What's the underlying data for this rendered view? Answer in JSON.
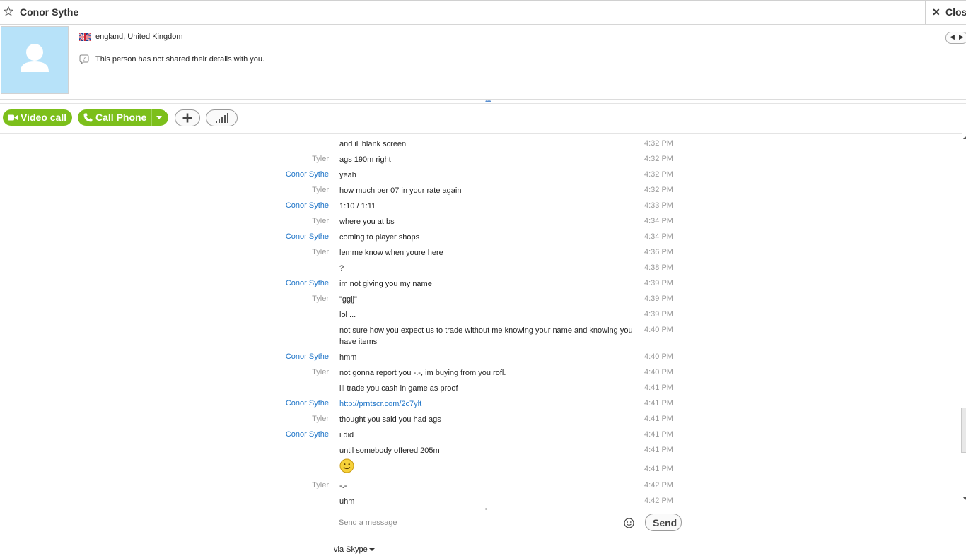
{
  "window": {
    "contact_name": "Conor Sythe",
    "close_label": "Close"
  },
  "profile": {
    "location": "england, United Kingdom",
    "details": "This person has not shared their details with you."
  },
  "toolbar": {
    "video_call_label": "Video call",
    "call_phone_label": "Call Phone"
  },
  "messages": [
    {
      "sender": "",
      "text": "and ill blank screen",
      "time": "4:32 PM"
    },
    {
      "sender": "Tyler",
      "text": "ags 190m right",
      "time": "4:32 PM"
    },
    {
      "sender": "Conor Sythe",
      "text": "yeah",
      "time": "4:32 PM"
    },
    {
      "sender": "Tyler",
      "text": "how much per 07 in your rate again",
      "time": "4:32 PM"
    },
    {
      "sender": "Conor Sythe",
      "text": "1:10  / 1:11",
      "time": "4:33 PM"
    },
    {
      "sender": "Tyler",
      "text": "where you at bs",
      "time": "4:34 PM"
    },
    {
      "sender": "Conor Sythe",
      "text": "coming to player shops",
      "time": "4:34 PM"
    },
    {
      "sender": "Tyler",
      "text": "lemme know when youre here",
      "time": "4:36 PM"
    },
    {
      "sender": "",
      "text": "?",
      "time": "4:38 PM"
    },
    {
      "sender": "Conor Sythe",
      "text": "im not giving you my name",
      "time": "4:39 PM"
    },
    {
      "sender": "Tyler",
      "text": "\"ggjj\"",
      "time": "4:39 PM"
    },
    {
      "sender": "",
      "text": "lol ...",
      "time": "4:39 PM"
    },
    {
      "sender": "",
      "text": "not sure how you expect us to trade without me knowing your name and knowing you have items",
      "time": "4:40 PM"
    },
    {
      "sender": "Conor Sythe",
      "text": "hmm",
      "time": "4:40 PM"
    },
    {
      "sender": "Tyler",
      "text": "not gonna report you -.-, im buying from you rofl.",
      "time": "4:40 PM"
    },
    {
      "sender": "",
      "text": "ill trade you cash in game as proof",
      "time": "4:41 PM"
    },
    {
      "sender": "Conor Sythe",
      "text": "http://prntscr.com/2c7ylt",
      "time": "4:41 PM",
      "link": true
    },
    {
      "sender": "Tyler",
      "text": "thought you said you had ags",
      "time": "4:41 PM"
    },
    {
      "sender": "Conor Sythe",
      "text": "i did",
      "time": "4:41 PM"
    },
    {
      "sender": "",
      "text": "until somebody offered 205m",
      "time": "4:41 PM"
    },
    {
      "sender": "",
      "text": "",
      "time": "4:41 PM",
      "emoticon": "smile-emoticon"
    },
    {
      "sender": "Tyler",
      "text": "-.-",
      "time": "4:42 PM"
    },
    {
      "sender": "",
      "text": "uhm",
      "time": "4:42 PM"
    }
  ],
  "composer": {
    "placeholder": "Send a message",
    "send_label": "Send",
    "via_label": "via Skype"
  },
  "colors": {
    "accent_green": "#7cbf1b",
    "link_blue": "#1f75c8",
    "avatar_bg": "#b7e2f9"
  },
  "icons": [
    "star-icon",
    "close-icon",
    "avatar-icon",
    "uk-flag-icon",
    "info-icon",
    "video-camera-icon",
    "phone-icon",
    "add-icon",
    "signal-icon",
    "smile-emoticon",
    "emoji-icon"
  ]
}
